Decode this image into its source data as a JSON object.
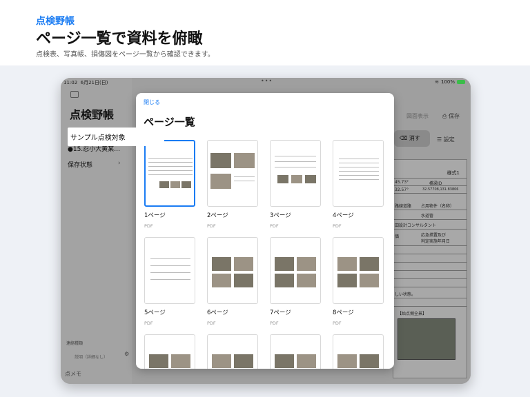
{
  "hero": {
    "brand": "点検野帳",
    "headline": "ページ一覧で資料を俯瞰",
    "subtitle": "点検表、写真帳、損傷図をページ一覧から確認できます。"
  },
  "statusbar": {
    "time": "11:02",
    "date": "6月21日(日)",
    "battery": "100%"
  },
  "sidebar": {
    "title": "点検野帳",
    "selected": "サンプル点検対象",
    "item2": "●15.忍小大黄某…",
    "item3": "保存状態",
    "foot1": "連絡種類",
    "foot2": "説明（詳細なし）",
    "foot3": "点メモ"
  },
  "toolbar": {
    "save": "保存",
    "erase": "消す",
    "settings": "設定",
    "faded": "図面表示"
  },
  "doc": {
    "form_no": "様式1",
    "cell1": "45.73°",
    "cell2": "橋梁ID",
    "cell3": "32.57°",
    "cell4": "32.57708,131.83806",
    "road": "路線道路",
    "occupancy": "占用物件（名称）",
    "pipe": "水道管",
    "consultant": "田設計コンサルタント",
    "measures": "応急措置及び",
    "judge_date": "判定実施年月日",
    "state": "しい状態。",
    "photo_label": "【始点側全景】"
  },
  "modal": {
    "close": "閉じる",
    "title": "ページ一覧",
    "pages": [
      {
        "label": "1ページ",
        "type": "PDF",
        "selected": true
      },
      {
        "label": "2ページ",
        "type": "PDF"
      },
      {
        "label": "3ページ",
        "type": "PDF"
      },
      {
        "label": "4ページ",
        "type": "PDF"
      },
      {
        "label": "5ページ",
        "type": "PDF"
      },
      {
        "label": "6ページ",
        "type": "PDF"
      },
      {
        "label": "7ページ",
        "type": "PDF"
      },
      {
        "label": "8ページ",
        "type": "PDF"
      },
      {
        "label": "",
        "type": ""
      },
      {
        "label": "",
        "type": ""
      },
      {
        "label": "",
        "type": ""
      },
      {
        "label": "",
        "type": ""
      }
    ]
  },
  "colors": {
    "accent": "#1a7cf3",
    "battery": "#3bbd4a"
  }
}
